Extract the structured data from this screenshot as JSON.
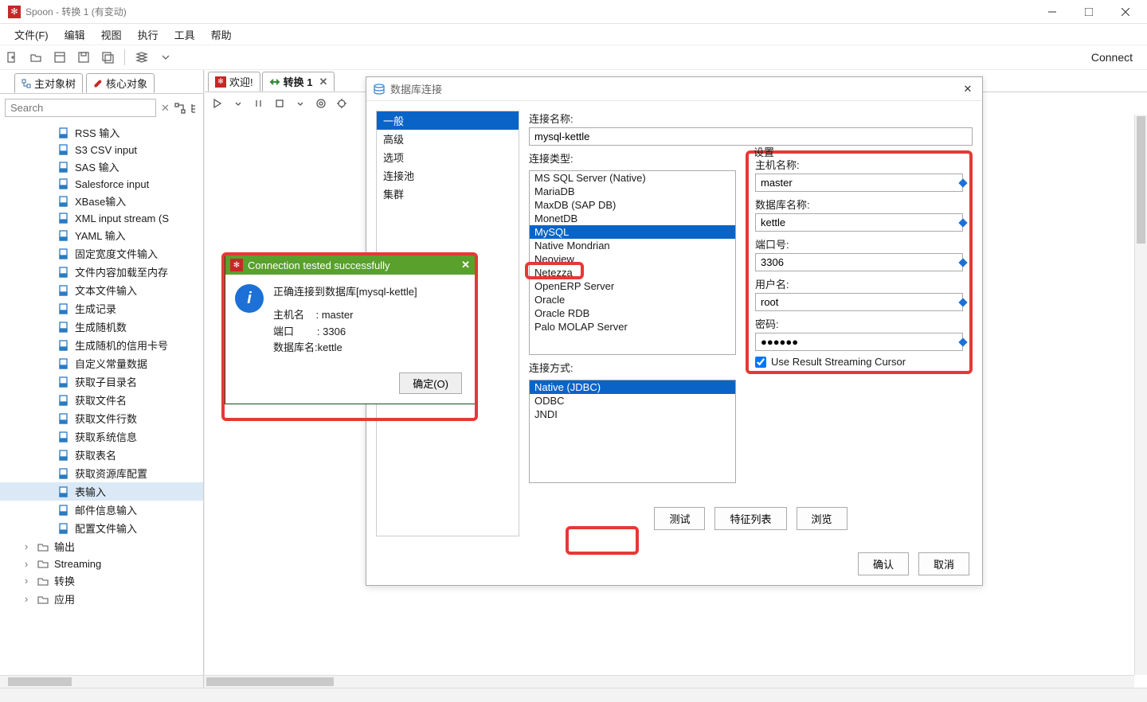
{
  "window": {
    "title": "Spoon - 转换 1 (有变动)",
    "connect_label": "Connect"
  },
  "menu": [
    "文件(F)",
    "编辑",
    "视图",
    "执行",
    "工具",
    "帮助"
  ],
  "left_tabs": {
    "tab1": "主对象树",
    "tab2": "核心对象"
  },
  "search_placeholder": "Search",
  "tree": {
    "items": [
      "RSS 输入",
      "S3 CSV input",
      "SAS 输入",
      "Salesforce input",
      "XBase输入",
      "XML input stream (S",
      "YAML 输入",
      "固定宽度文件输入",
      "文件内容加载至内存",
      "文本文件输入",
      "生成记录",
      "生成随机数",
      "生成随机的信用卡号",
      "自定义常量数据",
      "获取子目录名",
      "获取文件名",
      "获取文件行数",
      "获取系统信息",
      "获取表名",
      "获取资源库配置",
      "表输入",
      "邮件信息输入",
      "配置文件输入"
    ],
    "selected_index": 20,
    "folders": [
      "输出",
      "Streaming",
      "转换",
      "应用"
    ]
  },
  "right_tabs": {
    "welcome": "欢迎!",
    "trans": "转换 1"
  },
  "db_dialog": {
    "title": "数据库连接",
    "nav": [
      "一般",
      "高级",
      "选项",
      "连接池",
      "集群"
    ],
    "nav_selected": 0,
    "conn_name_label": "连接名称:",
    "conn_name_value": "mysql-kettle",
    "conn_type_label": "连接类型:",
    "conn_types": [
      "MS SQL Server (Native)",
      "MariaDB",
      "MaxDB (SAP DB)",
      "MonetDB",
      "MySQL",
      "Native Mondrian",
      "Neoview",
      "Netezza",
      "OpenERP Server",
      "Oracle",
      "Oracle RDB",
      "Palo MOLAP Server"
    ],
    "conn_type_selected": 4,
    "access_label": "连接方式:",
    "access": [
      "Native (JDBC)",
      "ODBC",
      "JNDI"
    ],
    "access_selected": 0,
    "settings_label": "设置",
    "fields": {
      "host_label": "主机名称:",
      "host_value": "master",
      "db_label": "数据库名称:",
      "db_value": "kettle",
      "port_label": "端口号:",
      "port_value": "3306",
      "user_label": "用户名:",
      "user_value": "root",
      "pass_label": "密码:",
      "pass_value": "●●●●●●"
    },
    "cb_label": "Use Result Streaming Cursor",
    "buttons": {
      "test": "测试",
      "features": "特征列表",
      "browse": "浏览"
    },
    "footer": {
      "ok": "确认",
      "cancel": "取消"
    }
  },
  "popup": {
    "title": "Connection tested successfully",
    "line1": "正确连接到数据库[mysql-kettle]",
    "host_label": "主机名",
    "host_value": "master",
    "port_label": "端口",
    "port_value": "3306",
    "db_line": "数据库名:kettle",
    "ok": "确定(O)"
  }
}
